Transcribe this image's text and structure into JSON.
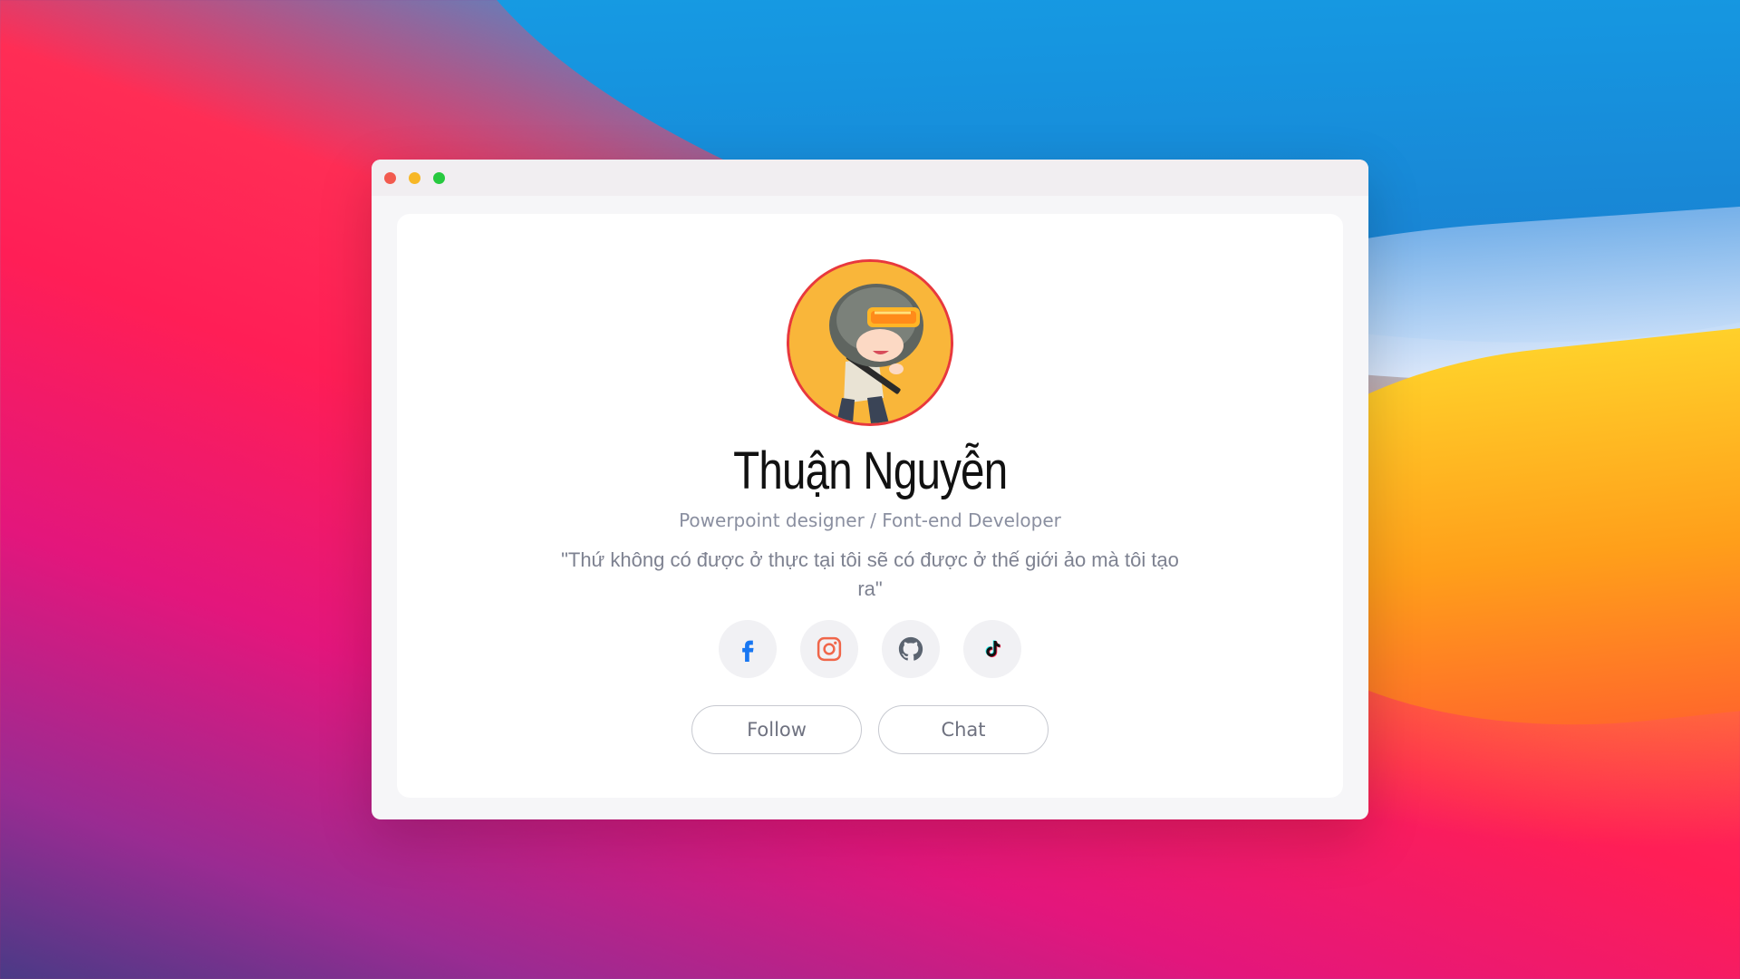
{
  "window": {
    "controls": [
      "close",
      "minimize",
      "maximize"
    ]
  },
  "profile": {
    "name": "Thuận Nguyễn",
    "role": "Powerpoint designer / Font-end Developer",
    "quote": "\"Thứ không có được ở thực tại tôi sẽ có được ở thế giới ảo mà tôi tạo ra\""
  },
  "socials": [
    {
      "icon": "facebook-icon"
    },
    {
      "icon": "instagram-icon"
    },
    {
      "icon": "github-icon"
    },
    {
      "icon": "tiktok-icon"
    }
  ],
  "actions": {
    "follow_label": "Follow",
    "chat_label": "Chat"
  },
  "colors": {
    "accent_ring": "#e8383d",
    "avatar_bg": "#f9b63a",
    "facebook": "#1877f2",
    "instagram": "#f0664a"
  }
}
